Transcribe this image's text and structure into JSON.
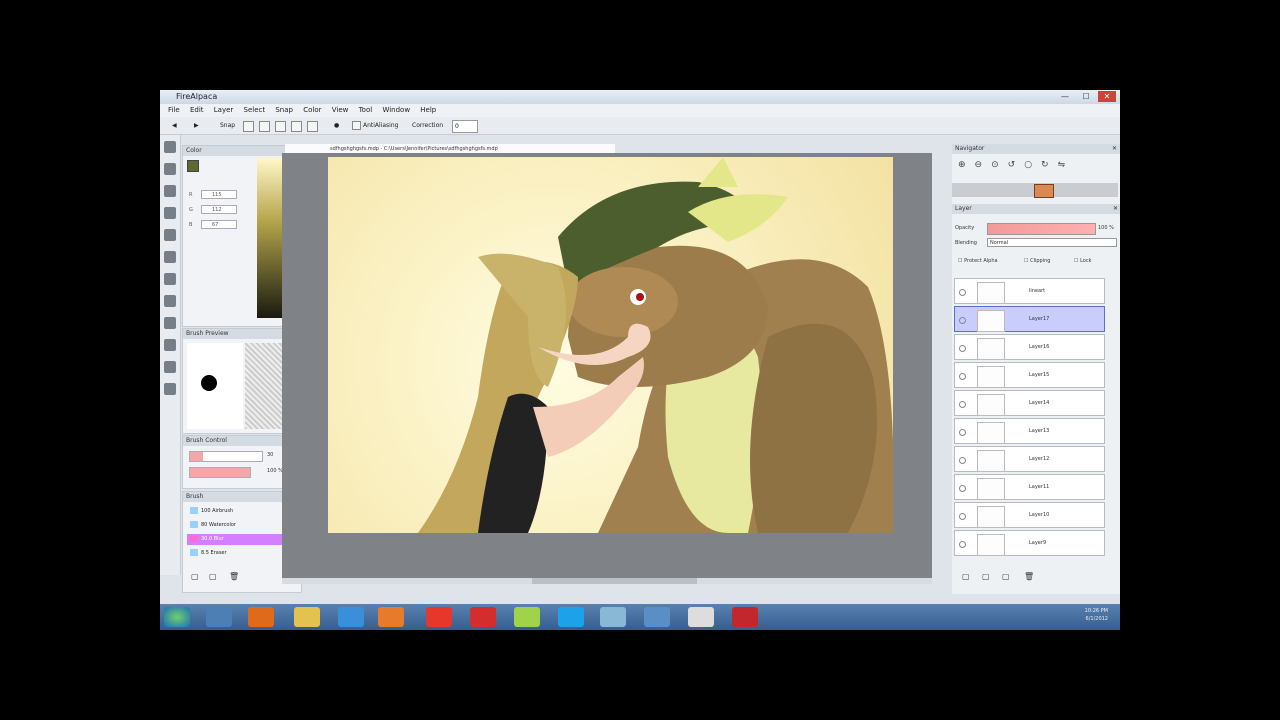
{
  "window": {
    "title": "FireAlpaca"
  },
  "menu": [
    "File",
    "Edit",
    "Layer",
    "Select",
    "Snap",
    "Color",
    "View",
    "Tool",
    "Window",
    "Help"
  ],
  "toolbar": {
    "snap_label": "Snap",
    "antialias_label": "AntiAliasing",
    "correction_label": "Correction",
    "correction_value": "0"
  },
  "document": {
    "tab": "sdfhgshghgsfs.mdp - C:\\Users\\Jennifer\\Pictures\\sdfhgshghgsfs.mdp"
  },
  "color_panel": {
    "title": "Color",
    "r": "115",
    "g": "112",
    "b": "67",
    "current_color": "#5d6b33"
  },
  "brush_preview": {
    "title": "Brush Preview"
  },
  "brush_control": {
    "title": "Brush Control",
    "size": "30",
    "opacity": "100 %"
  },
  "brush_panel": {
    "title": "Brush",
    "items": [
      {
        "size": "100",
        "name": "Airbrush",
        "color": "#9ad0ff"
      },
      {
        "size": "80",
        "name": "Watercolor",
        "color": "#9ad0ff"
      },
      {
        "size": "30.0",
        "name": "Blur",
        "color": "#ff69d4"
      },
      {
        "size": "8.5",
        "name": "Eraser",
        "color": "#9ad0ff"
      }
    ]
  },
  "navigator": {
    "title": "Navigator"
  },
  "layer_panel": {
    "title": "Layer",
    "opacity_label": "Opacity",
    "opacity_value": "100 %",
    "blending_label": "Blending",
    "blending_value": "Normal",
    "protect_alpha": "Protect Alpha",
    "clipping": "Clipping",
    "lock": "Lock",
    "layers": [
      "lineart",
      "Layer17",
      "Layer16",
      "Layer15",
      "Layer14",
      "Layer13",
      "Layer12",
      "Layer11",
      "Layer10",
      "Layer9"
    ]
  },
  "taskbar": {
    "clock_time": "10:26 PM",
    "clock_date": "6/1/2012"
  },
  "window_buttons": {
    "minimize": "—",
    "maximize": "☐",
    "close": "✕"
  }
}
